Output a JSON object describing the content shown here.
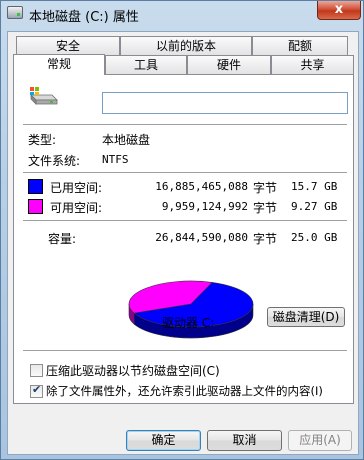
{
  "window": {
    "title": "本地磁盘 (C:) 属性",
    "close_label": "x"
  },
  "tabs_row1": [
    "安全",
    "以前的版本",
    "配额"
  ],
  "tabs_row2": [
    "常规",
    "工具",
    "硬件",
    "共享"
  ],
  "general": {
    "name_value": "",
    "type_label": "类型:",
    "type_value": "本地磁盘",
    "fs_label": "文件系统:",
    "fs_value": "NTFS"
  },
  "usage": {
    "used_label": "已用空间:",
    "used_bytes": "16,885,465,088",
    "used_unit": "字节",
    "used_human": "15.7 GB",
    "free_label": "可用空间:",
    "free_bytes": "9,959,124,992",
    "free_unit": "字节",
    "free_human": "9.27 GB",
    "cap_label": "容量:",
    "cap_bytes": "26,844,590,080",
    "cap_unit": "字节",
    "cap_human": "25.0 GB",
    "used_color": "#0000ff",
    "free_color": "#ff00ff",
    "used_fraction": 0.629
  },
  "drive_label": "驱动器 C:",
  "cleanup_button": "磁盘清理(D)",
  "checkboxes": {
    "compress": {
      "label": "压缩此驱动器以节约磁盘空间(C)",
      "checked": false
    },
    "index": {
      "label": "除了文件属性外，还允许索引此驱动器上文件的内容(I)",
      "checked": true
    }
  },
  "buttons": {
    "ok": "确定",
    "cancel": "取消",
    "apply": "应用(A)"
  }
}
